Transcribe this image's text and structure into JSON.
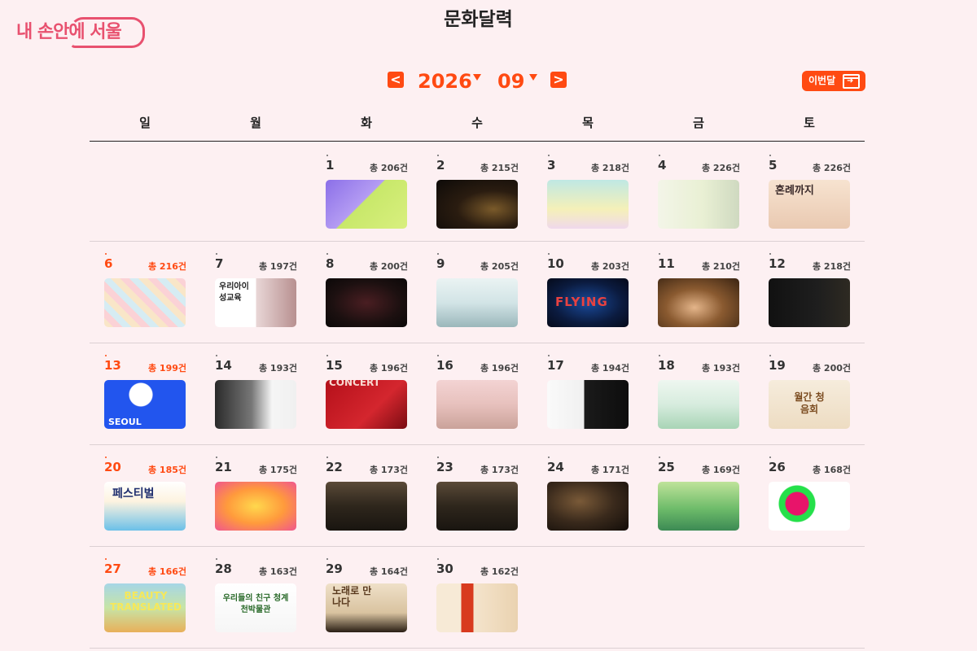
{
  "logo": {
    "text": "내 손안에 서울"
  },
  "page_title": "문화달력",
  "nav": {
    "prev_label": "<",
    "next_label": ">",
    "year": "2026",
    "month": "09",
    "this_month_label": "이번달"
  },
  "colors": {
    "accent": "#ff4a12",
    "background": "#fdf0f2",
    "logo": "#e8516f"
  },
  "weekdays": [
    "일",
    "월",
    "화",
    "수",
    "목",
    "금",
    "토"
  ],
  "days": [
    {
      "day": "1",
      "count": "총 206건",
      "thumb_text": ""
    },
    {
      "day": "2",
      "count": "총 215건",
      "thumb_text": ""
    },
    {
      "day": "3",
      "count": "총 218건",
      "thumb_text": ""
    },
    {
      "day": "4",
      "count": "총 226건",
      "thumb_text": ""
    },
    {
      "day": "5",
      "count": "총 226건",
      "thumb_text": "혼례까지"
    },
    {
      "day": "6",
      "count": "총 216건",
      "thumb_text": ""
    },
    {
      "day": "7",
      "count": "총 197건",
      "thumb_text": "우리아이 성교육"
    },
    {
      "day": "8",
      "count": "총 200건",
      "thumb_text": ""
    },
    {
      "day": "9",
      "count": "총 205건",
      "thumb_text": ""
    },
    {
      "day": "10",
      "count": "총 203건",
      "thumb_text": "FLYING"
    },
    {
      "day": "11",
      "count": "총 210건",
      "thumb_text": ""
    },
    {
      "day": "12",
      "count": "총 218건",
      "thumb_text": ""
    },
    {
      "day": "13",
      "count": "총 199건",
      "thumb_text": "SEOUL"
    },
    {
      "day": "14",
      "count": "총 193건",
      "thumb_text": ""
    },
    {
      "day": "15",
      "count": "총 196건",
      "thumb_text": "CONCERT"
    },
    {
      "day": "16",
      "count": "총 196건",
      "thumb_text": ""
    },
    {
      "day": "17",
      "count": "총 194건",
      "thumb_text": ""
    },
    {
      "day": "18",
      "count": "총 193건",
      "thumb_text": ""
    },
    {
      "day": "19",
      "count": "총 200건",
      "thumb_text": "월간 청음회"
    },
    {
      "day": "20",
      "count": "총 185건",
      "thumb_text": "페스티벌"
    },
    {
      "day": "21",
      "count": "총 175건",
      "thumb_text": ""
    },
    {
      "day": "22",
      "count": "총 173건",
      "thumb_text": ""
    },
    {
      "day": "23",
      "count": "총 173건",
      "thumb_text": ""
    },
    {
      "day": "24",
      "count": "총 171건",
      "thumb_text": ""
    },
    {
      "day": "25",
      "count": "총 169건",
      "thumb_text": ""
    },
    {
      "day": "26",
      "count": "총 168건",
      "thumb_text": ""
    },
    {
      "day": "27",
      "count": "총 166건",
      "thumb_text": "BEAUTY TRANSLATED"
    },
    {
      "day": "28",
      "count": "총 163건",
      "thumb_text": "우리들의 친구 청계천박물관"
    },
    {
      "day": "29",
      "count": "총 164건",
      "thumb_text": "노래로 만나다"
    },
    {
      "day": "30",
      "count": "총 162건",
      "thumb_text": ""
    }
  ]
}
